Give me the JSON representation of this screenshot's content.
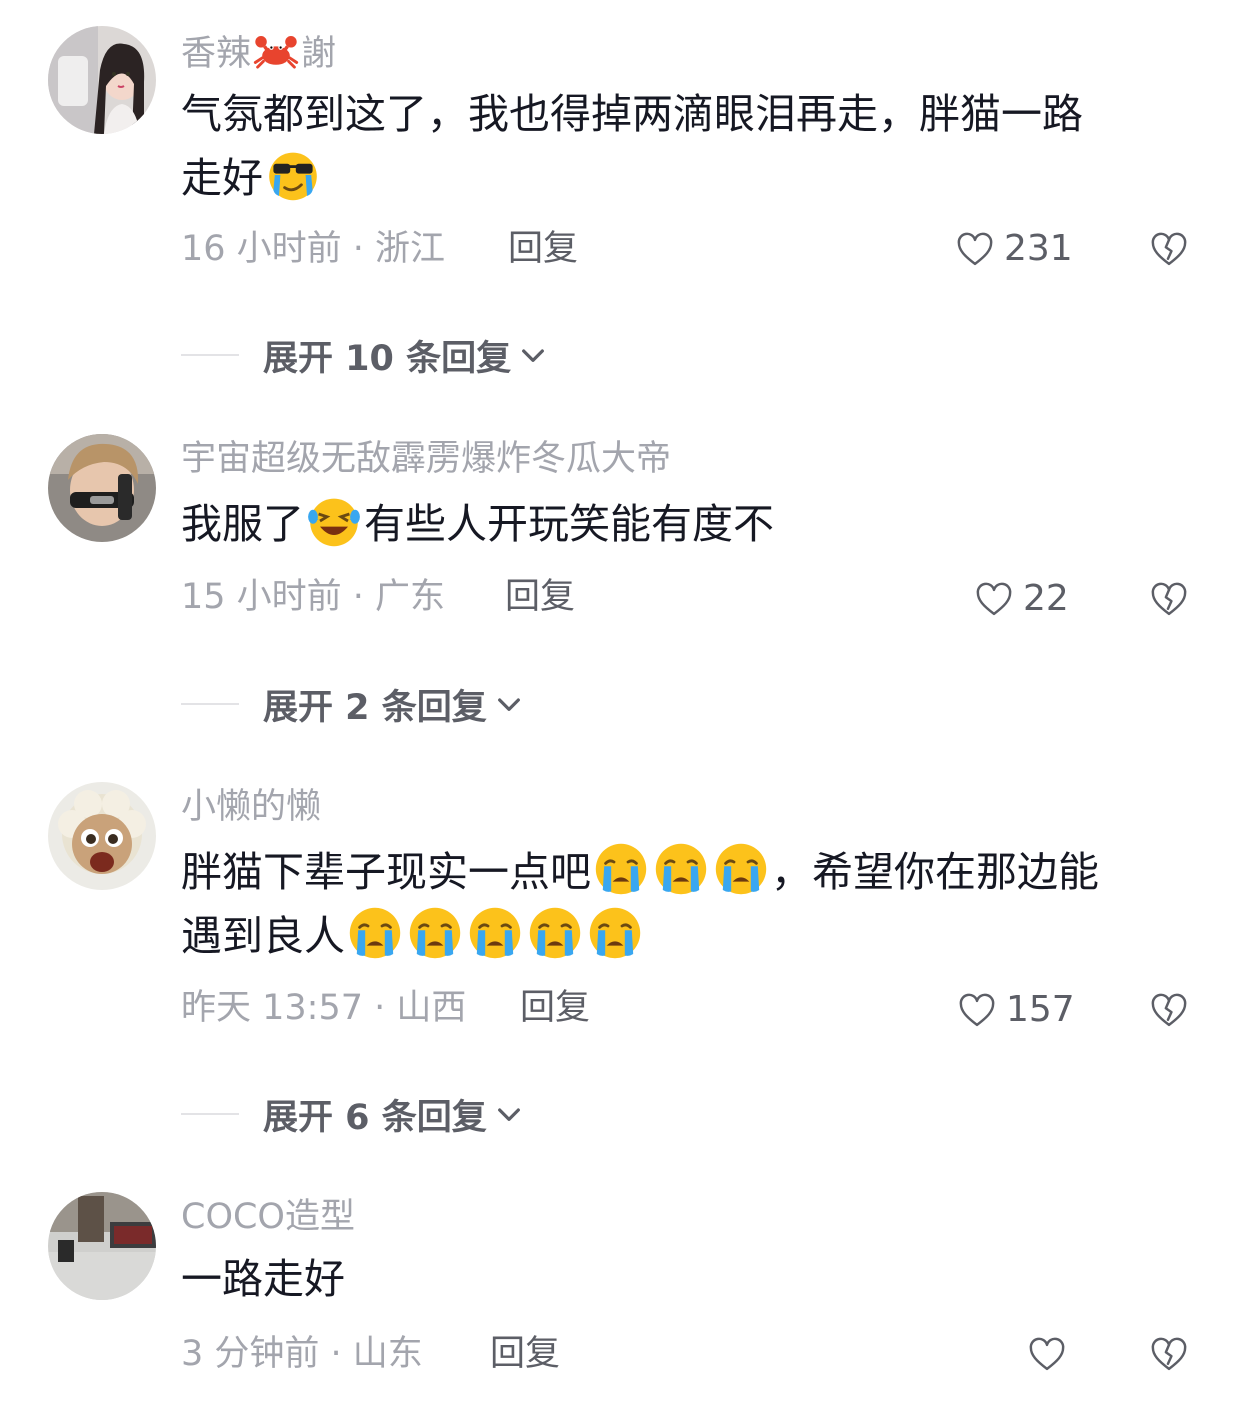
{
  "comments": [
    {
      "username": "香辣",
      "username_suffix": "謝",
      "text_line1": "气氛都到这了，我也得掉两滴眼泪再走，胖猫一路",
      "text_line2": "走好",
      "meta": "16 小时前 · 浙江",
      "reply_label": "回复",
      "likes": "231",
      "expand_label": "展开 10 条回复"
    },
    {
      "username": "宇宙超级无敌霹雳爆炸冬瓜大帝",
      "text_a": "我服了",
      "text_b": "有些人开玩笑能有度不",
      "meta": "15 小时前 · 广东",
      "reply_label": "回复",
      "likes": "22",
      "expand_label": "展开 2 条回复"
    },
    {
      "username": "小懒的懒",
      "text_a": "胖猫下辈子现实一点吧",
      "text_b": "，希望你在那边能",
      "text_c": "遇到良人",
      "meta": "昨天 13:57 · 山西",
      "reply_label": "回复",
      "likes": "157",
      "expand_label": "展开 6 条回复"
    },
    {
      "username": "COCO造型",
      "text": "一路走好",
      "meta": "3 分钟前 · 山东",
      "reply_label": "回复",
      "likes": ""
    }
  ],
  "icons": {
    "like": "heart-outline-icon",
    "dislike": "broken-heart-icon",
    "expand": "chevron-down-icon"
  },
  "colors": {
    "primary_text": "#161823",
    "secondary_text": "#a3a5ad",
    "action_text": "#5c5e66"
  }
}
